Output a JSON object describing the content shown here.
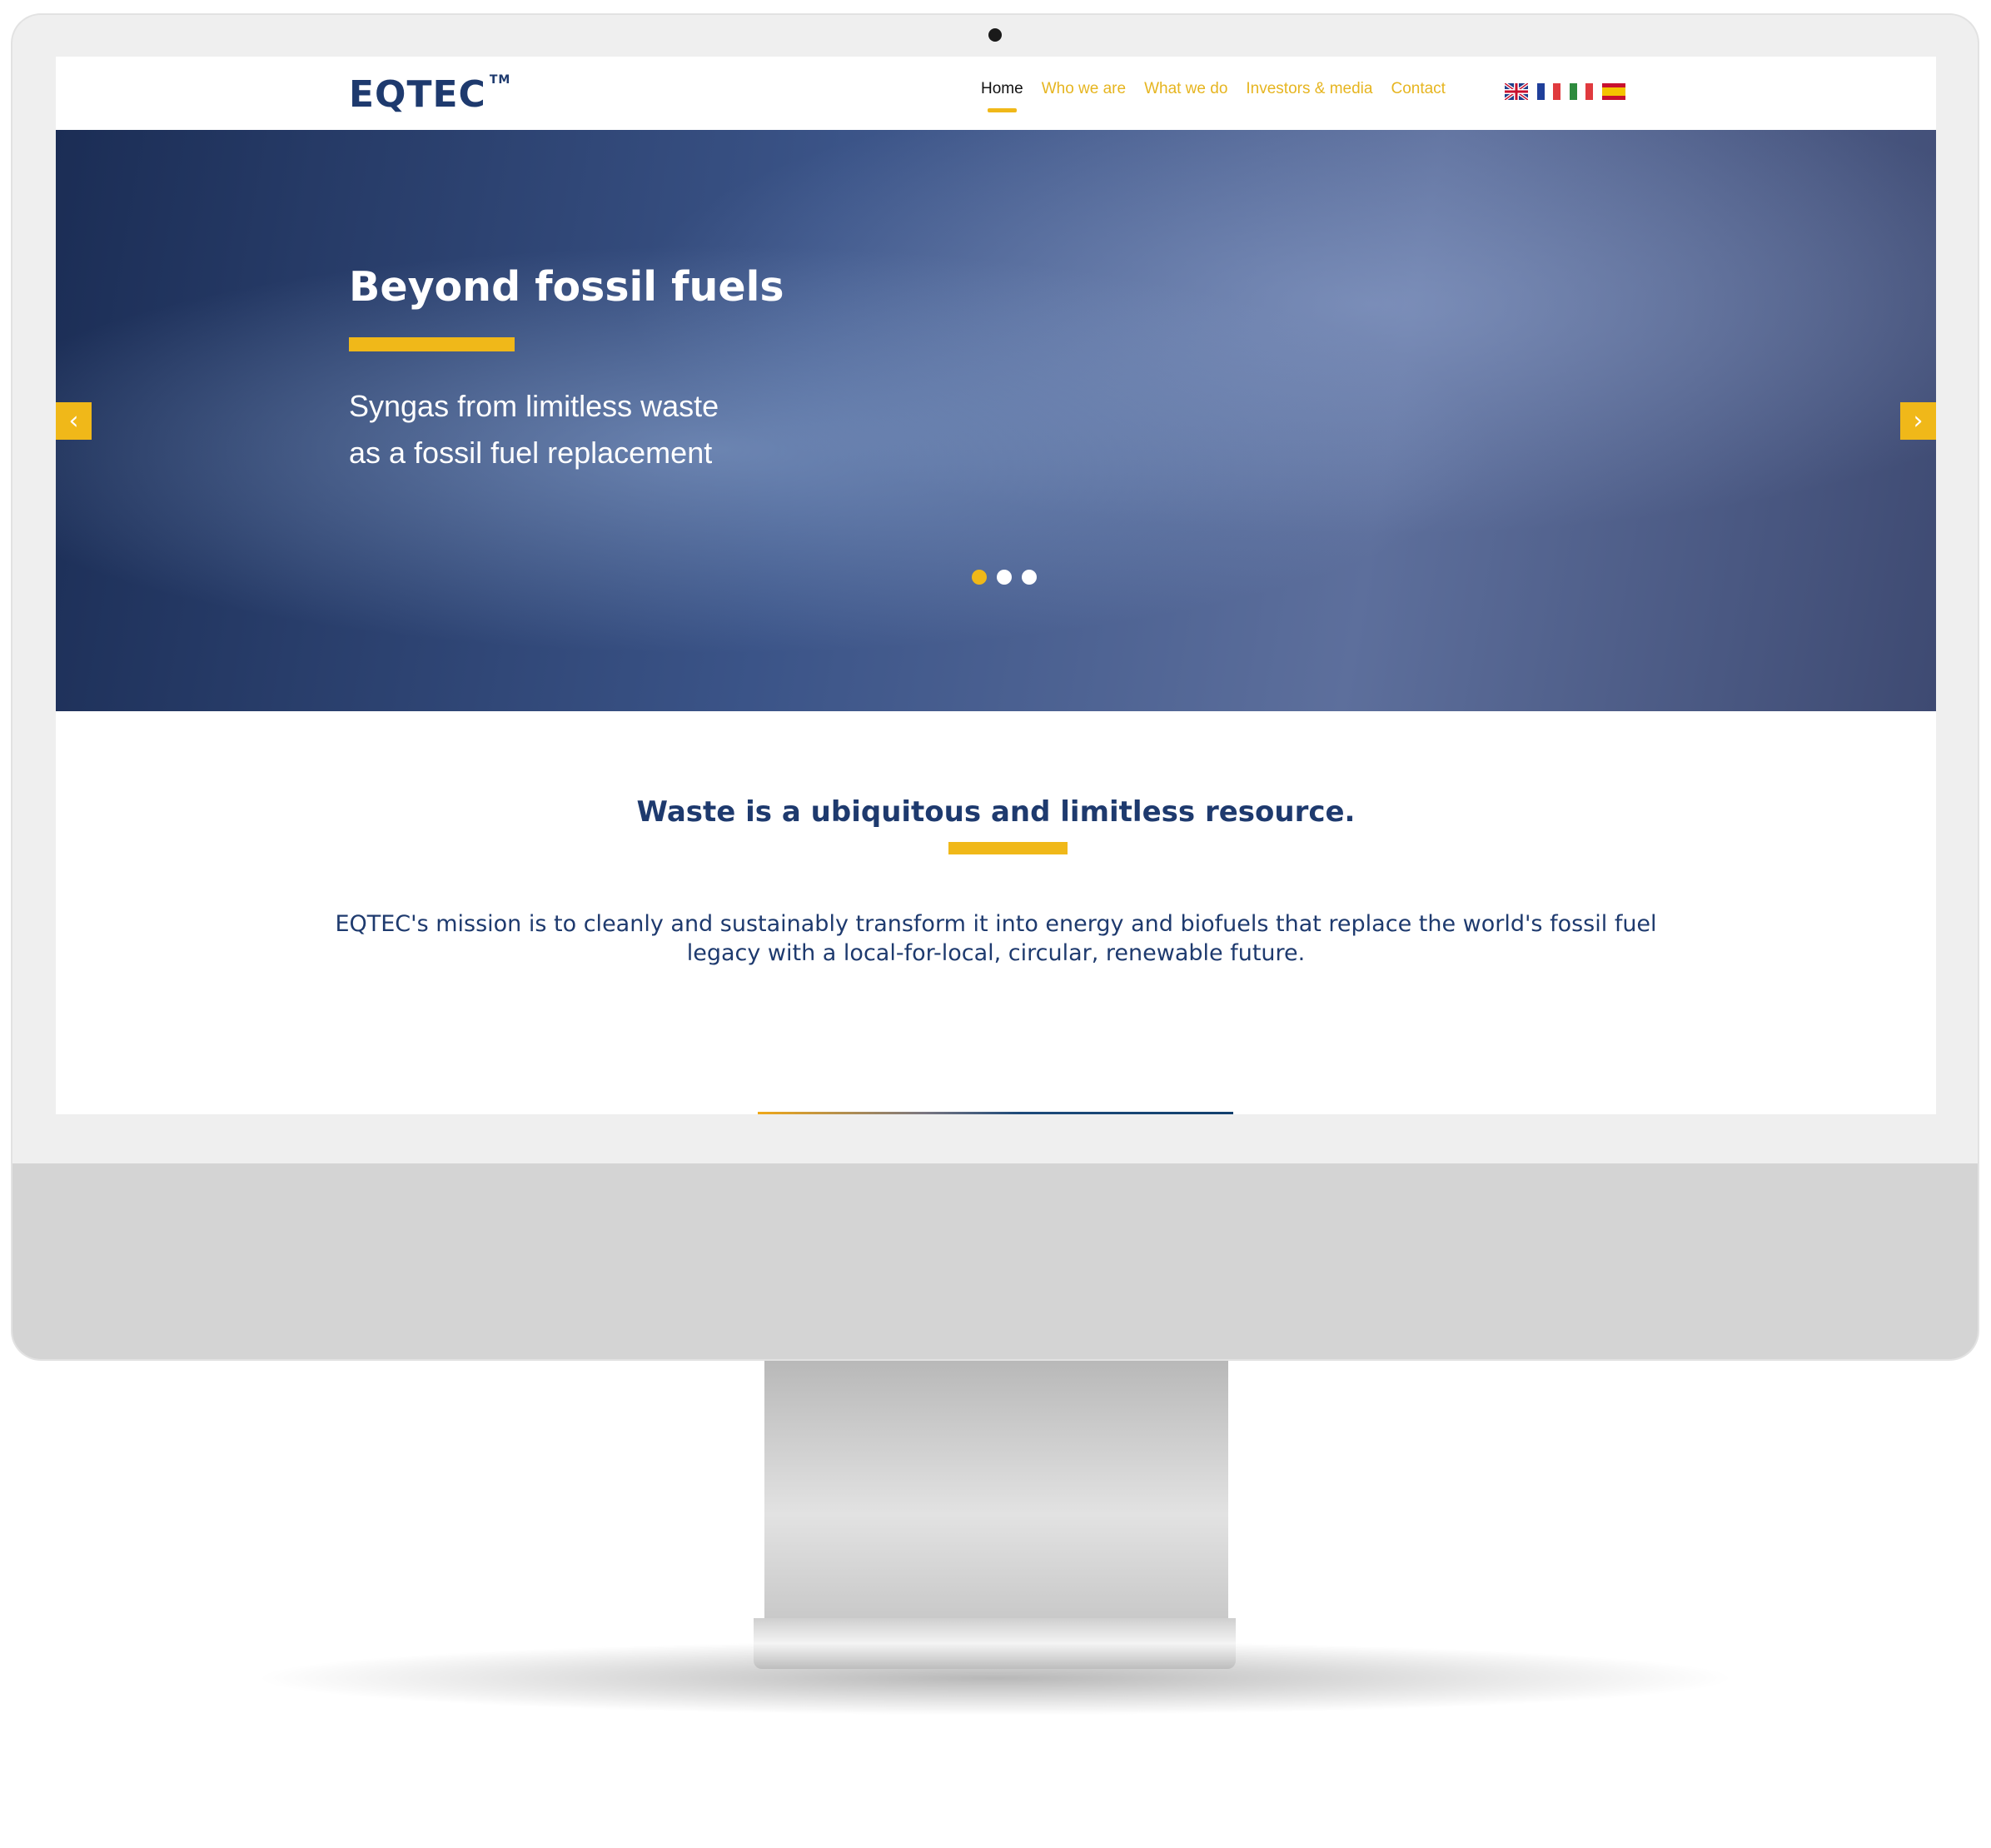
{
  "header": {
    "logo": "EQTEC",
    "logo_tm": "TM",
    "nav": [
      {
        "label": "Home",
        "active": true
      },
      {
        "label": "Who we are"
      },
      {
        "label": "What we do"
      },
      {
        "label": "Investors & media"
      },
      {
        "label": "Contact"
      }
    ],
    "languages": [
      "english-flag",
      "french-flag",
      "italian-flag",
      "spanish-flag"
    ]
  },
  "hero": {
    "title": "Beyond fossil fuels",
    "subtitle_line1": "Syngas from limitless waste",
    "subtitle_line2": "as a fossil fuel replacement",
    "prev": "‹",
    "next": "›",
    "slides": 3,
    "active_slide": 1
  },
  "intro": {
    "heading": "Waste is a ubiquitous and limitless resource.",
    "text": "EQTEC's mission is to cleanly and sustainably transform it into energy and biofuels that replace the world's fossil fuel legacy with a local-for-local, circular, renewable future."
  },
  "colors": {
    "accent": "#f0b819",
    "brand": "#1e3a6e"
  }
}
